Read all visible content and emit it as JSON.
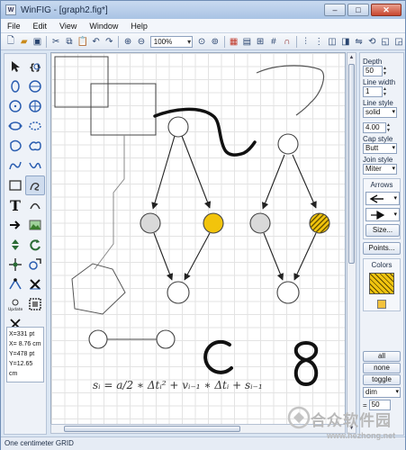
{
  "window": {
    "title": "WinFIG - [graph2.fig*]",
    "controls": {
      "minimize": "–",
      "maximize": "□",
      "close": "✕"
    }
  },
  "menu": [
    "File",
    "Edit",
    "View",
    "Window",
    "Help"
  ],
  "toolbar": {
    "zoom_value": "100%"
  },
  "coords": [
    "X=331 pt",
    "X= 8.76 cm",
    "Y=478 pt",
    "Y=12.65 cm"
  ],
  "canvas": {
    "formula": "sᵢ = a/2 ∗ Δtᵢ² + vᵢ₋₁ ∗ Δtᵢ + sᵢ₋₁",
    "colors": {
      "grey_node": "#d9d9d9",
      "yellow_node": "#f2c40c",
      "hatch_dark": "#5a4800",
      "grid": "#e3e3e3"
    }
  },
  "properties": {
    "depth_label": "Depth",
    "depth_value": "50",
    "line_width_label": "Line width",
    "line_width_value": "1",
    "line_style_label": "Line style",
    "line_style_value": "solid",
    "dash_value": "4.00",
    "cap_style_label": "Cap style",
    "cap_style_value": "Butt",
    "join_style_label": "Join style",
    "join_style_value": "Miter",
    "arrows_label": "Arrows",
    "size_button": "Size...",
    "points_button": "Points...",
    "colors_label": "Colors"
  },
  "selection": {
    "all": "all",
    "none": "none",
    "toggle": "toggle",
    "filter_value": "dim",
    "count_value": "50"
  },
  "status": {
    "text": "One centimeter GRID"
  },
  "watermark": {
    "text": "合众软件园",
    "url": "www.hezhong.net"
  }
}
